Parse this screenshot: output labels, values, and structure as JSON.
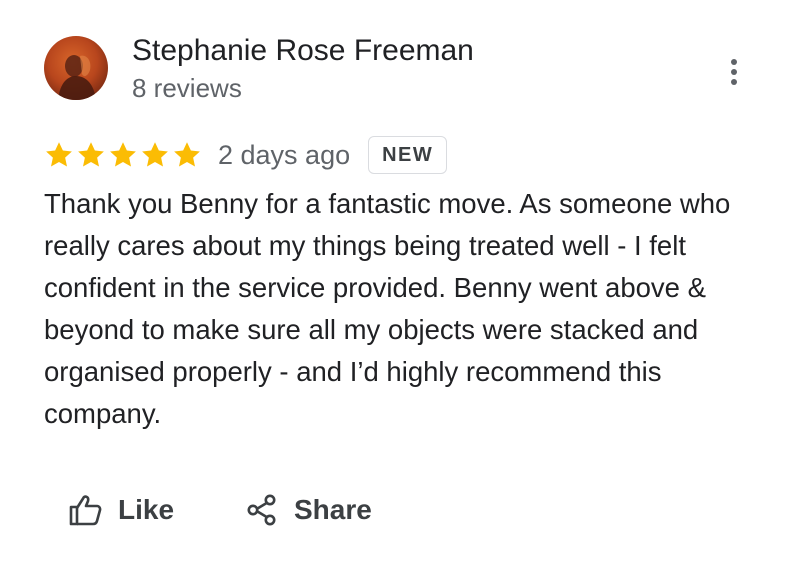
{
  "author": {
    "name": "Stephanie Rose Freeman",
    "review_count": "8 reviews",
    "avatar_icon": "profile-photo"
  },
  "menu": {
    "icon": "more-vert-icon"
  },
  "review": {
    "rating": 5,
    "rating_max": 5,
    "star_color": "#fbbc04",
    "date": "2 days ago",
    "badge": "NEW",
    "text": "Thank you Benny for a fantastic move. As someone who really cares about my things being treated well - I felt confident in the service provided. Benny went above & beyond to make sure all my objects were stacked and organised properly - and I’d highly recommend this company."
  },
  "actions": {
    "like_label": "Like",
    "like_icon": "thumb-up-icon",
    "share_label": "Share",
    "share_icon": "share-icon"
  }
}
